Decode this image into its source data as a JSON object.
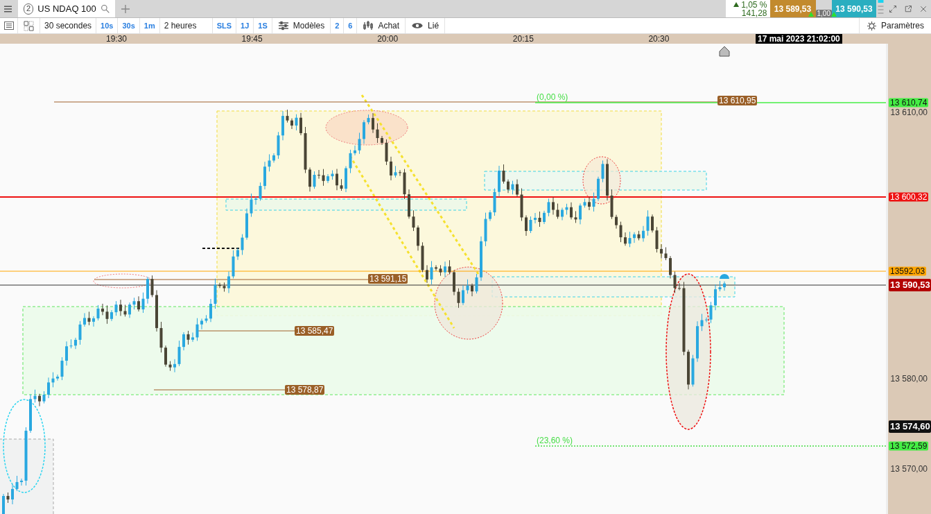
{
  "tab_bar": {
    "tabs": [
      {
        "number": "2",
        "label": "US NDAQ 100",
        "selected": true
      }
    ],
    "quote": {
      "change": "1,05 %",
      "points": "141,28",
      "bid": "13 589,53",
      "ask": "13 590,53",
      "spread": "1,00"
    }
  },
  "toolbar": {
    "items": [
      {
        "label": "30 secondes",
        "kind": "period"
      },
      {
        "label": "10s",
        "kind": "quick"
      },
      {
        "label": "30s",
        "kind": "quick"
      },
      {
        "label": "1m",
        "kind": "quick"
      },
      {
        "label": "2 heures",
        "kind": "period"
      },
      {
        "label": "SLS",
        "kind": "quick"
      },
      {
        "label": "1J",
        "kind": "quick"
      },
      {
        "label": "1S",
        "kind": "quick"
      },
      {
        "label": "Modèles",
        "kind": "templates"
      },
      {
        "label": "2",
        "kind": "quick"
      },
      {
        "label": "6",
        "kind": "quick"
      },
      {
        "label": "Achat",
        "kind": "order"
      },
      {
        "label": "Lié",
        "kind": "link"
      }
    ],
    "settings": "Paramètres"
  },
  "time_axis": {
    "labels": [
      "19:30",
      "19:45",
      "20:00",
      "20:15",
      "20:30"
    ],
    "cursor_time": "17 mai 2023 21:02:00"
  },
  "price_axis": {
    "ticks": [
      "13 610,00",
      "13 580,00",
      "13 570,00"
    ],
    "labels": [
      {
        "text": "13 610,74",
        "color": "#44ee44"
      },
      {
        "text": "13 600,32",
        "color": "#ee1111"
      },
      {
        "text": "13592.03",
        "color": "#ffa500"
      },
      {
        "text": "13 590,53",
        "color": "#b30000"
      },
      {
        "text": "13 574,60",
        "color": "#111111"
      },
      {
        "text": "13 572,59",
        "color": "#44ee44"
      }
    ]
  },
  "chart": {
    "level_labels": [
      "13 610,95",
      "13 591,15",
      "13 585,47",
      "13 578,87"
    ],
    "fib_labels": [
      "(0,00 %)",
      "(23,60 %)"
    ]
  }
}
